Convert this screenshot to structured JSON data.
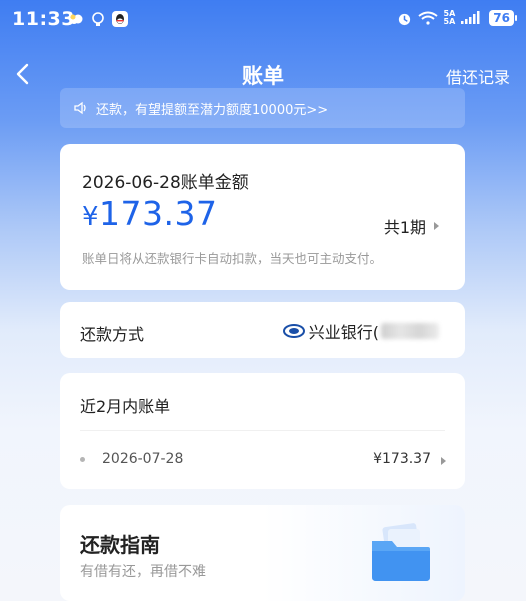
{
  "status_bar": {
    "time": "11:33",
    "network": [
      "5A",
      "5A"
    ],
    "battery": "76"
  },
  "header": {
    "title": "账单",
    "right_link": "借还记录"
  },
  "notice": {
    "text": "还款，有望提额至潜力额度10000元>>"
  },
  "bill": {
    "title": "2026-06-28账单金额",
    "currency": "¥",
    "amount": "173.37",
    "periods": "共1期",
    "note": "账单日将从还款银行卡自动扣款，当天也可主动支付。"
  },
  "repayment_method": {
    "label": "还款方式",
    "bank": "兴业银行("
  },
  "recent_bills": {
    "title": "近2月内账单",
    "items": [
      {
        "date": "2026-07-28",
        "amount": "¥173.37"
      }
    ]
  },
  "guide": {
    "title": "还款指南",
    "subtitle": "有借有还，再借不难"
  },
  "colors": {
    "accent": "#1e63e8",
    "header_bg": "#3f7df2"
  }
}
